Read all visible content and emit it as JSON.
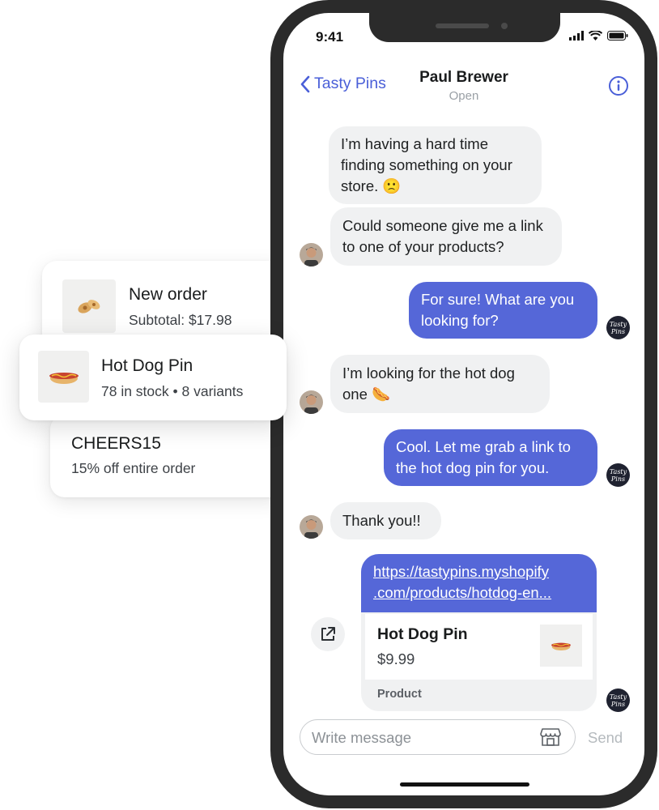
{
  "cards": {
    "order": {
      "title": "New order",
      "subtitle": "Subtotal: $17.98",
      "icon": "pin-product-image"
    },
    "product": {
      "title": "Hot Dog Pin",
      "subtitle": "78 in stock • 8 variants",
      "icon": "hotdog-pin-image"
    },
    "discount": {
      "title": "CHEERS15",
      "subtitle": "15% off entire order"
    }
  },
  "status_bar": {
    "time": "9:41",
    "icons": [
      "signal-icon",
      "wifi-icon",
      "battery-icon"
    ]
  },
  "header": {
    "back_label": "Tasty Pins",
    "contact_name": "Paul Brewer",
    "contact_status": "Open",
    "info_icon": "info-icon"
  },
  "store_avatar_text": "Tasty\nPins",
  "messages": [
    {
      "from": "customer",
      "text": "I’m having a hard time finding something on your store. 🙁"
    },
    {
      "from": "customer",
      "text": "Could someone give me a link to one of your products?"
    },
    {
      "from": "store",
      "text": "For sure! What are you looking for?"
    },
    {
      "from": "customer",
      "text": "I’m looking for the hot dog one 🌭"
    },
    {
      "from": "store",
      "text": "Cool. Let me grab a link to the hot dog pin for you."
    },
    {
      "from": "customer",
      "text": "Thank you!!"
    }
  ],
  "link_card": {
    "url_line1": "https://tastypins.myshopify",
    "url_line2": ".com/products/hotdog-en...",
    "product_title": "Hot Dog Pin",
    "price": "$9.99",
    "type": "Product"
  },
  "composer": {
    "placeholder": "Write message",
    "send_label": "Send"
  },
  "colors": {
    "accent": "#5567d8",
    "incoming": "#f0f1f2",
    "link": "#4a5fd8"
  }
}
